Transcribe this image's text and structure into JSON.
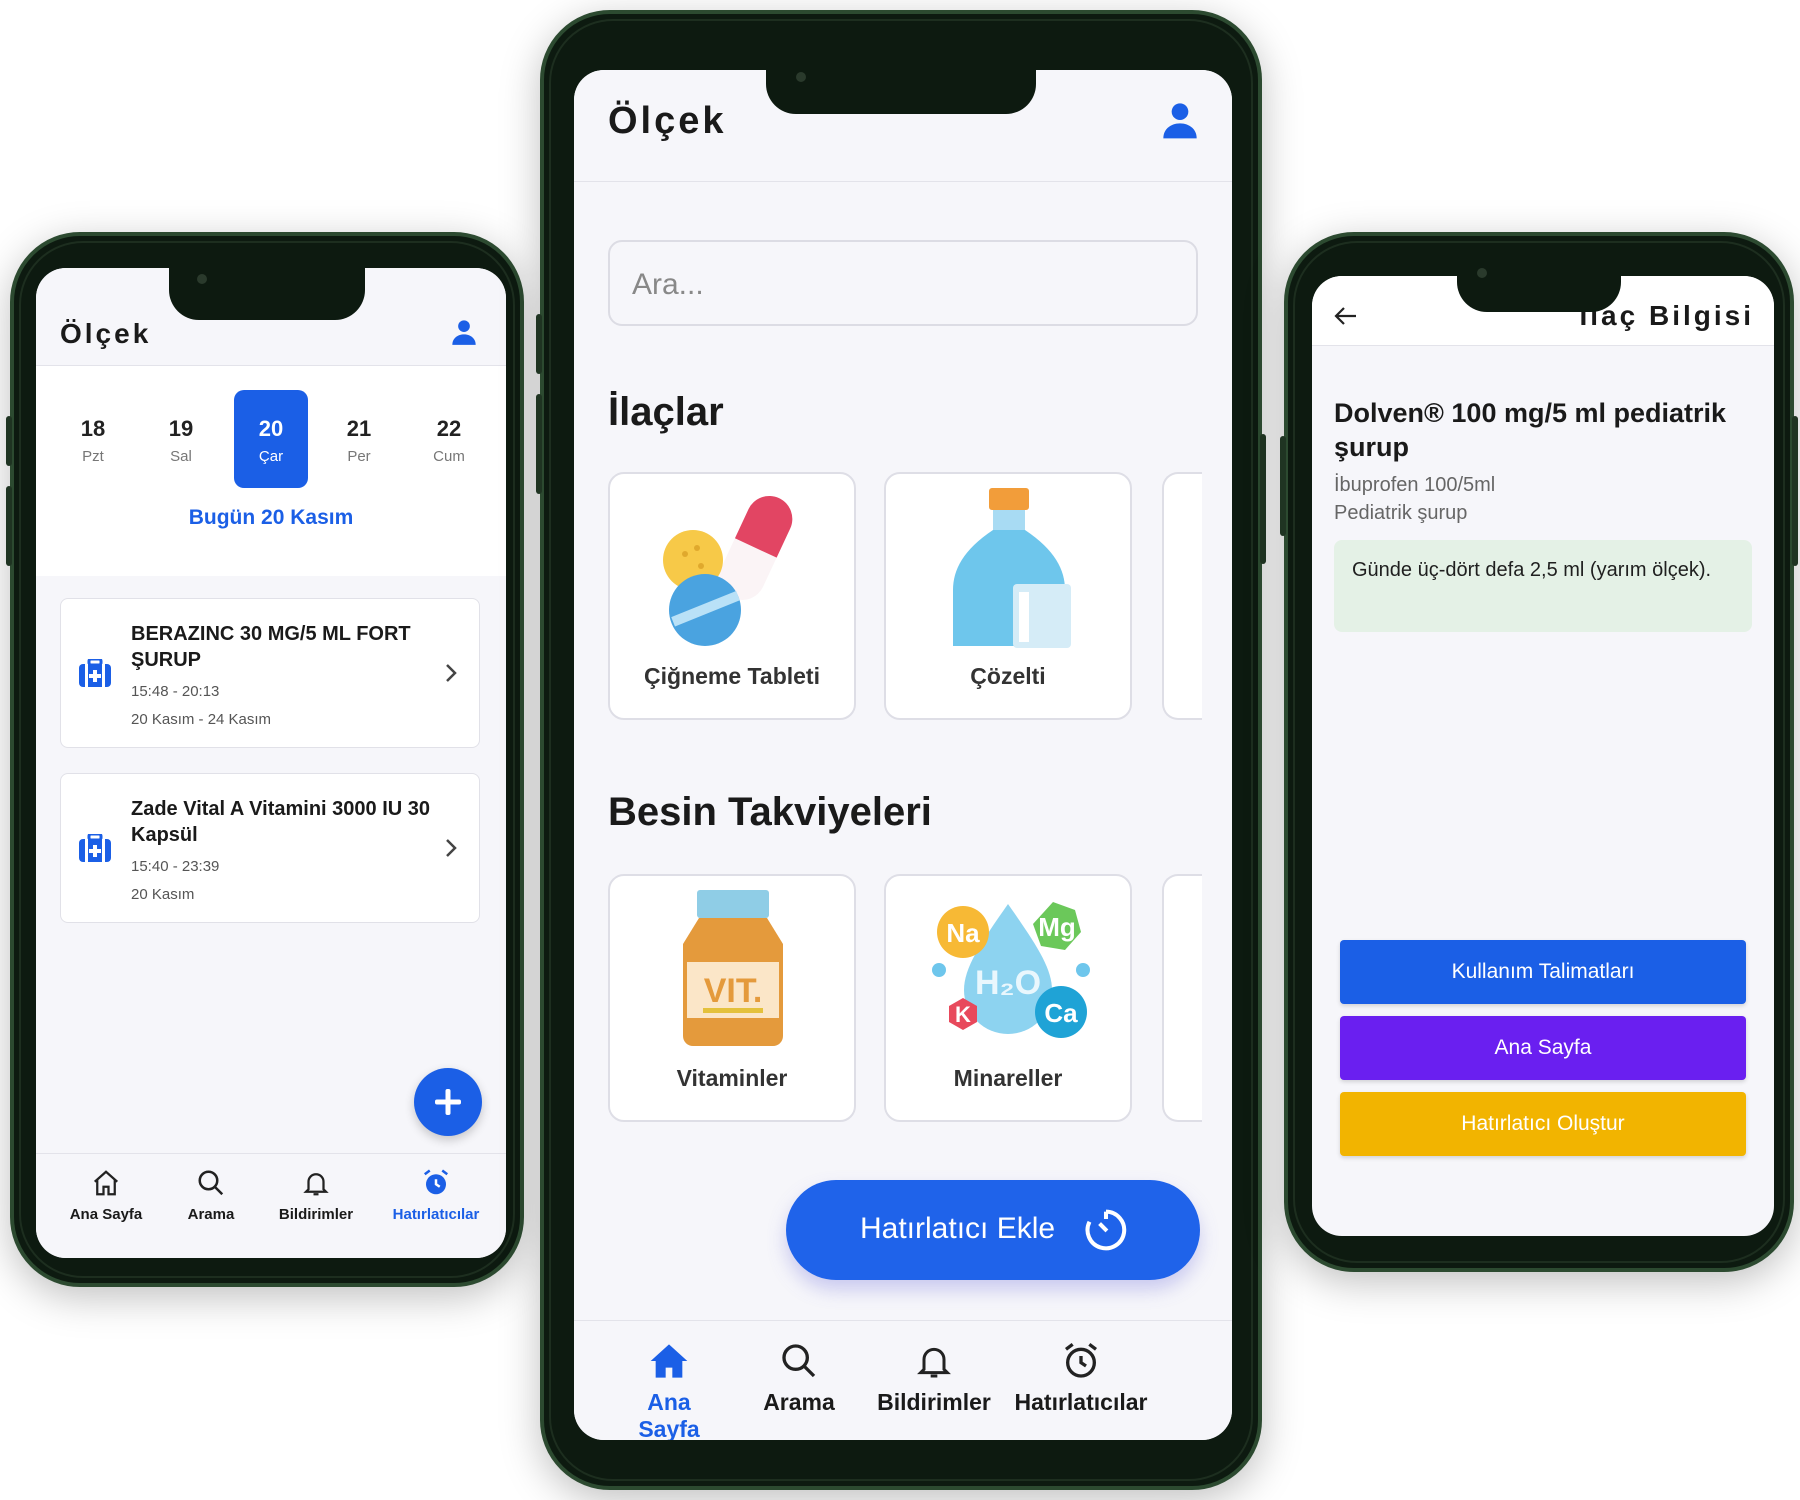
{
  "colors": {
    "accent": "#1b5fe6",
    "purple": "#6a1ff0",
    "yellow": "#f2b400",
    "success_bg": "#e4f1e6"
  },
  "left": {
    "brand": "Ölçek",
    "dates": [
      {
        "num": "18",
        "day": "Pzt"
      },
      {
        "num": "19",
        "day": "Sal"
      },
      {
        "num": "20",
        "day": "Çar"
      },
      {
        "num": "21",
        "day": "Per"
      },
      {
        "num": "22",
        "day": "Cum"
      }
    ],
    "today": "Bugün 20 Kasım",
    "reminders": [
      {
        "title": "BERAZINC 30 MG/5 ML FORT ŞURUP",
        "time": "15:48 - 20:13",
        "range": "20 Kasım - 24 Kasım"
      },
      {
        "title": "Zade Vital A Vitamini 3000 IU 30 Kapsül",
        "time": "15:40 - 23:39",
        "range": "20 Kasım"
      }
    ],
    "nav": [
      {
        "label": "Ana Sayfa",
        "icon": "home-icon"
      },
      {
        "label": "Arama",
        "icon": "search-icon"
      },
      {
        "label": "Bildirimler",
        "icon": "bell-icon"
      },
      {
        "label": "Hatırlatıcılar",
        "icon": "alarm-icon"
      }
    ]
  },
  "middle": {
    "brand": "Ölçek",
    "search_placeholder": "Ara...",
    "section_drugs": "İlaçlar",
    "drug_tiles": [
      "Çiğneme Tableti",
      "Çözelti"
    ],
    "section_supplements": "Besin Takviyeleri",
    "supplement_tiles": [
      "Vitaminler",
      "Minareller"
    ],
    "add_reminder": "Hatırlatıcı Ekle",
    "nav": [
      {
        "label": "Ana Sayfa",
        "icon": "home-icon"
      },
      {
        "label": "Arama",
        "icon": "search-icon"
      },
      {
        "label": "Bildirimler",
        "icon": "bell-icon"
      },
      {
        "label": "Hatırlatıcılar",
        "icon": "alarm-icon"
      }
    ]
  },
  "right": {
    "title": "İlaç Bilgisi",
    "drug_name": "Dolven® 100 mg/5 ml pediatrik şurup",
    "active_ingredient": "İbuprofen 100/5ml",
    "form": "Pediatrik şurup",
    "dosage": "Günde üç-dört defa 2,5 ml (yarım ölçek).",
    "btn_instructions": "Kullanım Talimatları",
    "btn_home": "Ana Sayfa",
    "btn_create_reminder": "Hatırlatıcı Oluştur"
  }
}
